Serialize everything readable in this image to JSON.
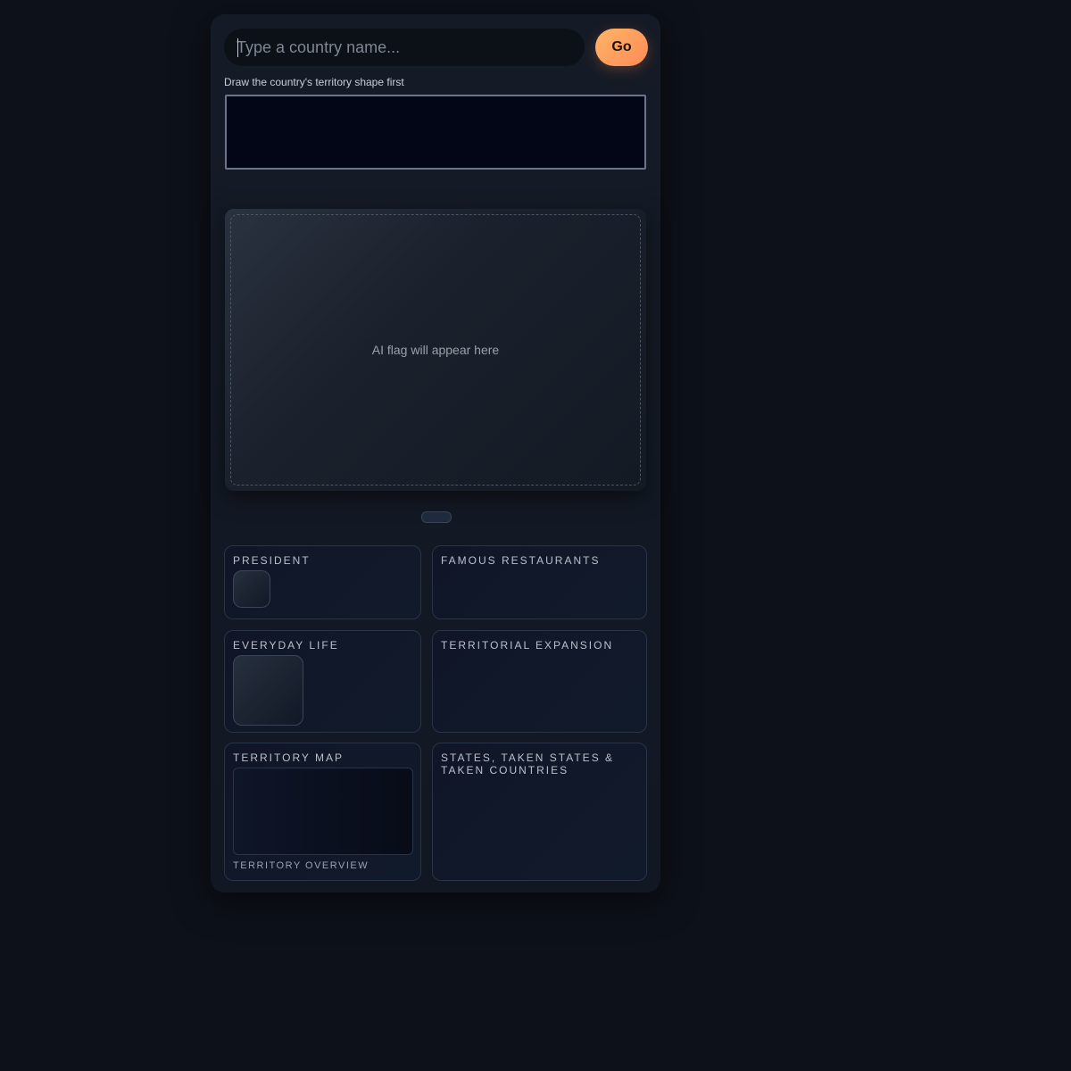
{
  "search": {
    "placeholder": "Type a country name...",
    "value": "",
    "go_label": "Go"
  },
  "draw": {
    "label": "Draw the country's territory shape first"
  },
  "flag": {
    "placeholder": "AI flag will appear here"
  },
  "cards": {
    "president": {
      "title": "PRESIDENT"
    },
    "restaurants": {
      "title": "FAMOUS RESTAURANTS"
    },
    "everyday": {
      "title": "EVERYDAY LIFE"
    },
    "expansion": {
      "title": "TERRITORIAL EXPANSION"
    },
    "territory_map": {
      "title": "TERRITORY MAP",
      "subtitle": "TERRITORY OVERVIEW"
    },
    "states": {
      "title": "STATES, TAKEN STATES & TAKEN COUNTRIES"
    }
  },
  "colors": {
    "background": "#0d1119",
    "panel": "#141a25",
    "accent": "#ff9a5c",
    "card": "#101628"
  }
}
